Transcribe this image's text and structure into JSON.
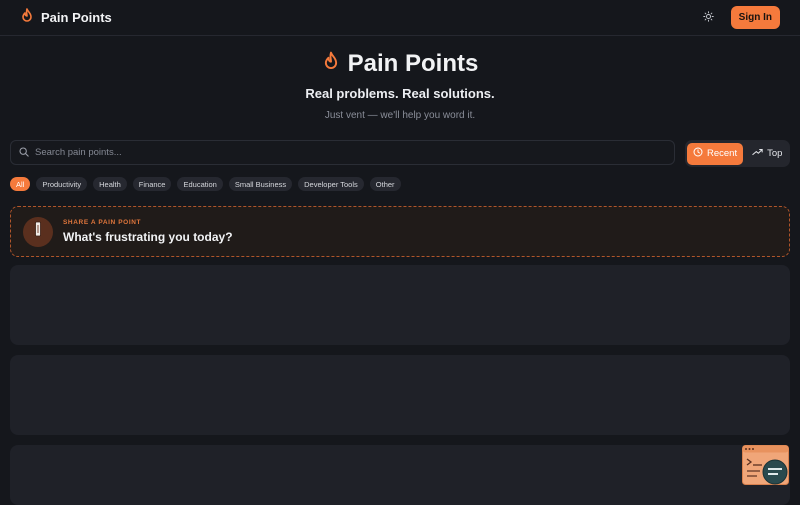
{
  "header": {
    "brand": "Pain Points",
    "signin_label": "Sign In"
  },
  "hero": {
    "title": "Pain Points",
    "subtitle": "Real problems. Real solutions.",
    "tagline": "Just vent — we'll help you word it."
  },
  "search": {
    "placeholder": "Search pain points...",
    "value": ""
  },
  "sort": {
    "recent_label": "Recent",
    "top_label": "Top",
    "active": "Recent"
  },
  "categories": {
    "all": "All",
    "productivity": "Productivity",
    "health": "Health",
    "finance": "Finance",
    "education": "Education",
    "small_business": "Small Business",
    "developer_tools": "Developer Tools",
    "other": "Other"
  },
  "share": {
    "kicker": "SHARE A PAIN POINT",
    "prompt": "What's frustrating you today?"
  },
  "icons": {
    "brand": "flame-icon",
    "theme": "sun-icon",
    "search": "search-icon",
    "recent": "clock-icon",
    "top": "trending-up-icon",
    "share": "microphone-icon",
    "widget": "terminal-widget-icon"
  },
  "colors": {
    "accent": "#f57a3c",
    "background": "#15171c",
    "card": "#1f2128",
    "chip": "#262830"
  }
}
